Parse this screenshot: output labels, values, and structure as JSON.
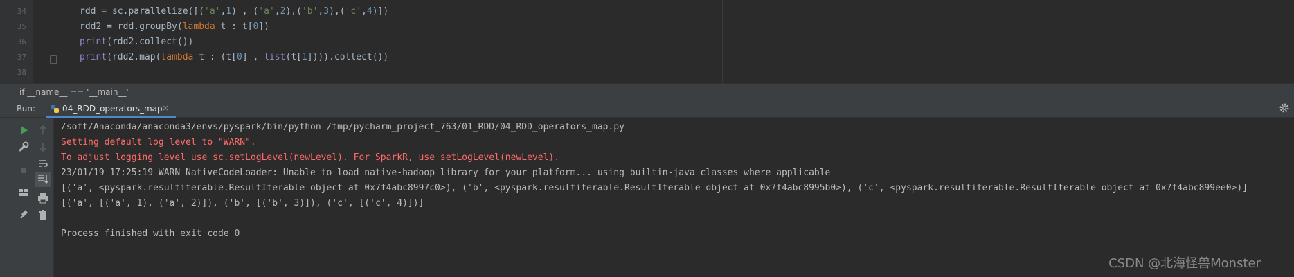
{
  "editor": {
    "line_numbers": [
      "34",
      "35",
      "36",
      "37",
      "38"
    ],
    "code": {
      "l34_prefix": "rdd = sc.parallelize([(",
      "l34_s1": "'a'",
      "l34_c1": ",",
      "l34_n1": "1",
      "l34_m1": ") , (",
      "l34_s2": "'a'",
      "l34_c2": ",",
      "l34_n2": "2",
      "l34_m2": "),(",
      "l34_s3": "'b'",
      "l34_c3": ",",
      "l34_n3": "3",
      "l34_m3": "),(",
      "l34_s4": "'c'",
      "l34_c4": ",",
      "l34_n4": "4",
      "l34_end": ")])",
      "l35_prefix": "rdd2 = rdd.groupBy(",
      "l35_kw": "lambda",
      "l35_mid": " t : t[",
      "l35_n": "0",
      "l35_end": "])",
      "l36_fn": "print",
      "l36_rest": "(rdd2.collect())",
      "l37_fn": "print",
      "l37_a": "(rdd2.map(",
      "l37_kw": "lambda",
      "l37_b": " t : (t[",
      "l37_n0": "0",
      "l37_c": "] , ",
      "l37_list": "list",
      "l37_d": "(t[",
      "l37_n1": "1",
      "l37_e": "]))).collect())"
    }
  },
  "breadcrumb": "if __name__ == '__main__'",
  "run": {
    "label": "Run:",
    "tab_label": "04_RDD_operators_map",
    "close_symbol": "×"
  },
  "console": {
    "lines": [
      "/soft/Anaconda/anaconda3/envs/pyspark/bin/python /tmp/pycharm_project_763/01_RDD/04_RDD_operators_map.py",
      "Setting default log level to \"WARN\".",
      "To adjust logging level use sc.setLogLevel(newLevel). For SparkR, use setLogLevel(newLevel).",
      "23/01/19 17:25:19 WARN NativeCodeLoader: Unable to load native-hadoop library for your platform... using builtin-java classes where applicable",
      "[('a', <pyspark.resultiterable.ResultIterable object at 0x7f4abc8997c0>), ('b', <pyspark.resultiterable.ResultIterable object at 0x7f4abc8995b0>), ('c', <pyspark.resultiterable.ResultIterable object at 0x7f4abc899ee0>)]",
      "[('a', [('a', 1), ('a', 2)]), ('b', [('b', 3)]), ('c', [('c', 4)])]",
      "",
      "Process finished with exit code 0"
    ]
  },
  "watermark": "CSDN @北海怪兽Monster",
  "colors": {
    "accent": "#4a88c7",
    "error": "#ff6b68",
    "run_green": "#499c54"
  },
  "icons": [
    "run-icon",
    "wrench-icon",
    "stop-icon",
    "layout-icon",
    "pin-icon",
    "up-arrow-icon",
    "down-arrow-icon",
    "soft-wrap-icon",
    "scroll-to-end-icon",
    "print-icon",
    "trash-icon",
    "python-file-icon",
    "gear-icon"
  ]
}
